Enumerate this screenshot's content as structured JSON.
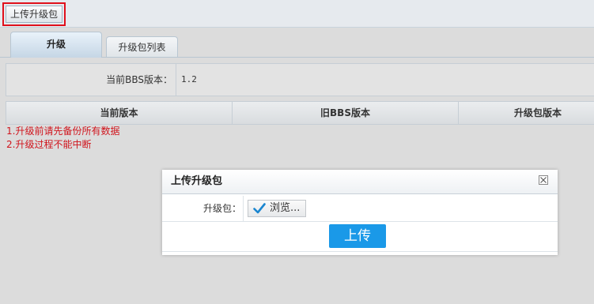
{
  "toolbar": {
    "upload_label": "上传升级包"
  },
  "tabs": [
    {
      "label": "升级"
    },
    {
      "label": "升级包列表"
    }
  ],
  "info": {
    "label": "当前BBS版本：",
    "value": "1.2"
  },
  "grid": {
    "columns": [
      "当前版本",
      "旧BBS版本",
      "升级包版本"
    ]
  },
  "notes": [
    "1.升级前请先备份所有数据",
    "2.升级过程不能中断"
  ],
  "modal": {
    "title": "上传升级包",
    "field_label": "升级包：",
    "browse_label": "浏览...",
    "submit_label": "上传"
  },
  "colors": {
    "accent": "#1a99e8",
    "warning": "#d0141c",
    "highlight": "#e0101c"
  },
  "icons": {
    "close": "close-icon",
    "browse": "checkmark-icon"
  }
}
